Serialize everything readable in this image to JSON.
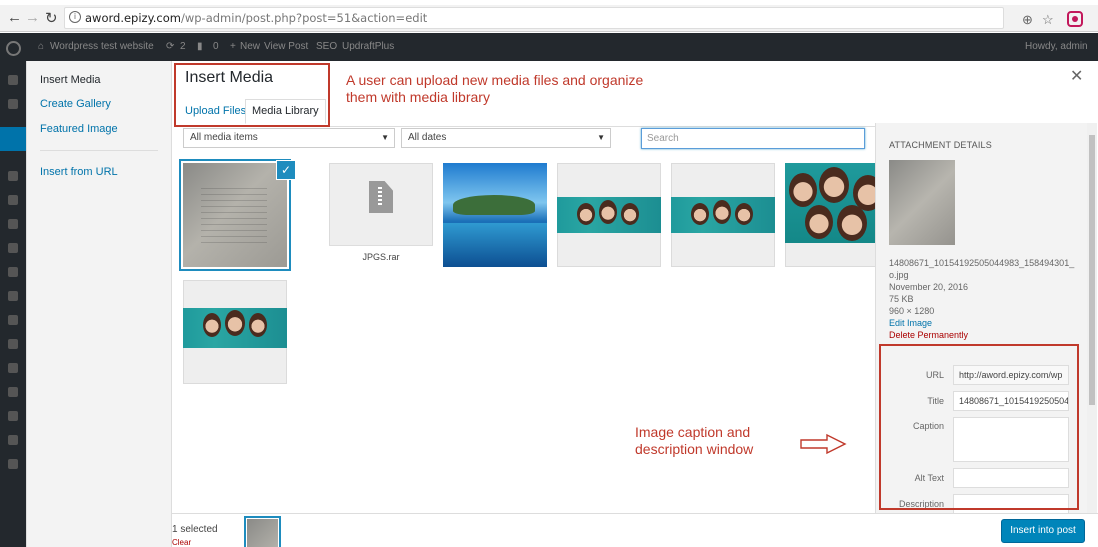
{
  "browser": {
    "url_host": "aword.epizy.com",
    "url_path": "/wp-admin/post.php?post=51&action=edit"
  },
  "adminbar": {
    "site_name": "Wordpress test website",
    "updates": "2",
    "comments": "0",
    "new": "New",
    "view_post": "View Post",
    "seo": "SEO",
    "updraft": "UpdraftPlus",
    "howdy": "Howdy, admin"
  },
  "menu": {
    "items": [
      "Insert Media",
      "Create Gallery",
      "Featured Image",
      "Insert from URL"
    ]
  },
  "frame": {
    "title": "Insert Media",
    "tabs": [
      "Upload Files",
      "Media Library"
    ]
  },
  "annotations": {
    "top": "A user can upload new media files and organize them with media library",
    "top_line1": "A user can upload new media files and organize",
    "top_line2": "them with media library",
    "side_line1": "Image caption and",
    "side_line2": "description window"
  },
  "toolbar": {
    "filter_type": "All media items",
    "filter_date": "All dates",
    "search_placeholder": "Search"
  },
  "attachments": [
    {
      "kind": "photo-document",
      "selected": true
    },
    {
      "kind": "file",
      "filename": "JPGS.rar"
    },
    {
      "kind": "photo-island"
    },
    {
      "kind": "photo-group-wide"
    },
    {
      "kind": "photo-group-wide"
    },
    {
      "kind": "photo-group-close"
    },
    {
      "kind": "photo-group-wide"
    }
  ],
  "details": {
    "heading": "ATTACHMENT DETAILS",
    "filename_line1": "14808671_10154192505044983_158494301_",
    "filename_line2": "o.jpg",
    "date": "November 20, 2016",
    "size": "75 KB",
    "dimensions": "960 × 1280",
    "edit_link": "Edit Image",
    "delete_link": "Delete Permanently",
    "fields": {
      "url_label": "URL",
      "url_value": "http://aword.epizy.com/wp",
      "title_label": "Title",
      "title_value": "14808671_1015419250504",
      "caption_label": "Caption",
      "alt_label": "Alt Text",
      "description_label": "Description"
    }
  },
  "bottom": {
    "selected_count": "1 selected",
    "clear": "Clear",
    "insert_button": "Insert into post"
  },
  "colors": {
    "wp_blue": "#0073aa",
    "primary_button": "#0085ba",
    "annotation_red": "#c0392b",
    "admin_dark": "#23282d"
  }
}
